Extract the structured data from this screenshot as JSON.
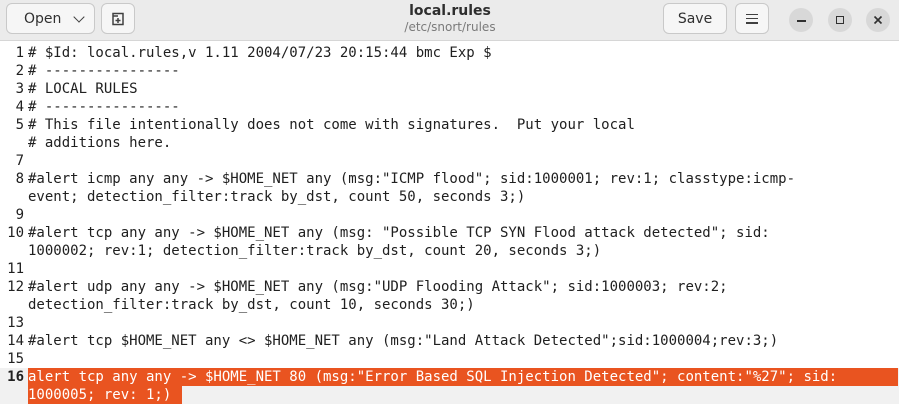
{
  "header": {
    "open_label": "Open",
    "save_label": "Save",
    "title": "local.rules",
    "subtitle": "/etc/snort/rules"
  },
  "editor": {
    "lines": [
      {
        "num": "1",
        "rows": [
          "# $Id: local.rules,v 1.11 2004/07/23 20:15:44 bmc Exp $"
        ]
      },
      {
        "num": "2",
        "rows": [
          "# ----------------"
        ]
      },
      {
        "num": "3",
        "rows": [
          "# LOCAL RULES"
        ]
      },
      {
        "num": "4",
        "rows": [
          "# ----------------"
        ]
      },
      {
        "num": "5",
        "rows": [
          "# This file intentionally does not come with signatures.  Put your local"
        ]
      },
      {
        "num": "",
        "rows": [
          "# additions here."
        ]
      },
      {
        "num": "7",
        "rows": [
          ""
        ]
      },
      {
        "num": "8",
        "rows": [
          "#alert icmp any any -> $HOME_NET any (msg:\"ICMP flood\"; sid:1000001; rev:1; classtype:icmp-",
          "event; detection_filter:track by_dst, count 50, seconds 3;)"
        ]
      },
      {
        "num": "9",
        "rows": [
          ""
        ]
      },
      {
        "num": "10",
        "rows": [
          "#alert tcp any any -> $HOME_NET any (msg: \"Possible TCP SYN Flood attack detected\"; sid:",
          "1000002; rev:1; detection_filter:track by_dst, count 20, seconds 3;)"
        ]
      },
      {
        "num": "11",
        "rows": [
          ""
        ]
      },
      {
        "num": "12",
        "rows": [
          "#alert udp any any -> $HOME_NET any (msg:\"UDP Flooding Attack\"; sid:1000003; rev:2;",
          "detection_filter:track by_dst, count 10, seconds 30;)"
        ]
      },
      {
        "num": "13",
        "rows": [
          ""
        ]
      },
      {
        "num": "14",
        "rows": [
          "#alert tcp $HOME_NET any <> $HOME_NET any (msg:\"Land Attack Detected\";sid:1000004;rev:3;)"
        ]
      },
      {
        "num": "15",
        "rows": [
          ""
        ]
      },
      {
        "num": "16",
        "rows": [
          "alert tcp any any -> $HOME_NET 80 (msg:\"Error Based SQL Injection Detected\"; content:\"%27\"; sid:",
          "1000005; rev: 1;)"
        ]
      }
    ]
  }
}
